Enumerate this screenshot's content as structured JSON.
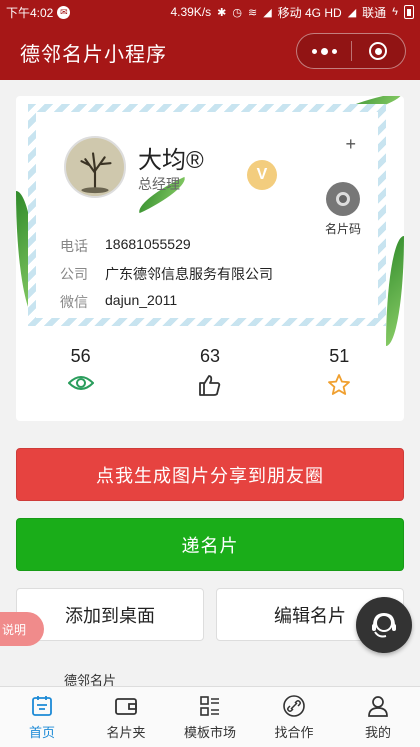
{
  "status_bar": {
    "time": "下午4:02",
    "network_speed": "4.39K/s",
    "carrier_1": "移动 4G HD",
    "carrier_2": "联通"
  },
  "title_bar": {
    "title": "德邻名片小程序"
  },
  "card": {
    "name": "大均®",
    "position": "总经理",
    "v_badge": "V",
    "plus": "+",
    "qr_label": "名片码",
    "rows": [
      {
        "key": "电话",
        "value": "18681055529"
      },
      {
        "key": "公司",
        "value": "广东德邻信息服务有限公司"
      },
      {
        "key": "微信",
        "value": "dajun_2011"
      }
    ]
  },
  "stats": [
    {
      "value": "56",
      "icon": "eye-icon",
      "color": "#2a9d5c"
    },
    {
      "value": "63",
      "icon": "thumbs-up-icon",
      "color": "#333333"
    },
    {
      "value": "51",
      "icon": "star-icon",
      "color": "#f0a030"
    }
  ],
  "buttons": {
    "share": "点我生成图片分享到朋友圈",
    "pass_card": "递名片",
    "add_desktop": "添加到桌面",
    "edit_card": "编辑名片"
  },
  "explain_tab": "说明",
  "footer_label": "德邻名片",
  "tabbar": [
    {
      "label": "首页",
      "icon": "home-icon",
      "active": true
    },
    {
      "label": "名片夹",
      "icon": "wallet-icon",
      "active": false
    },
    {
      "label": "模板市场",
      "icon": "grid-list-icon",
      "active": false
    },
    {
      "label": "找合作",
      "icon": "link-icon",
      "active": false
    },
    {
      "label": "我的",
      "icon": "user-icon",
      "active": false
    }
  ],
  "colors": {
    "brand": "#a61717",
    "share_button": "#e64340",
    "pass_button": "#1aad19",
    "tab_active": "#1d8ad6"
  }
}
